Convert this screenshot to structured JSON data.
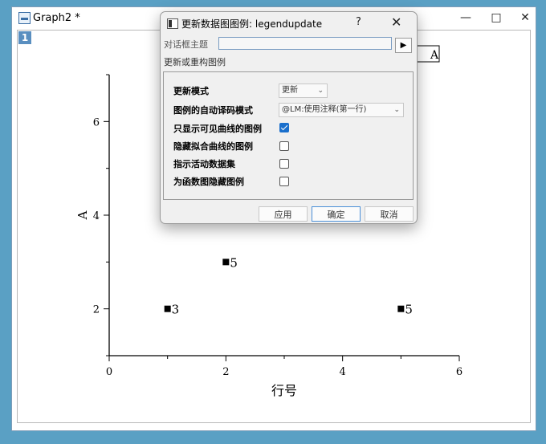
{
  "graph_window": {
    "title": "Graph2 *",
    "layer_number": "1",
    "controls": {
      "minimize": "—",
      "maximize": "□",
      "close": "✕"
    }
  },
  "dialog": {
    "title": "更新数据图图例: legendupdate",
    "help": "?",
    "close": "✕",
    "theme_label": "对话框主题",
    "theme_value": "",
    "section_label": "更新或重构图例",
    "options": {
      "update_mode_label": "更新模式",
      "update_mode_value": "更新",
      "auto_translate_label": "图例的自动译码模式",
      "auto_translate_value": "@LM:使用注释(第一行)",
      "visible_only_label": "只显示可见曲线的图例",
      "visible_only_checked": true,
      "hide_fit_label": "隐藏拟合曲线的图例",
      "hide_fit_checked": false,
      "active_dataset_label": "指示活动数据集",
      "active_dataset_checked": false,
      "hide_function_label": "为函数图隐藏图例",
      "hide_function_checked": false
    },
    "buttons": {
      "apply": "应用",
      "ok": "确定",
      "cancel": "取消"
    }
  },
  "chart_data": {
    "type": "scatter",
    "xlabel": "行号",
    "ylabel": "A",
    "xlim": [
      0,
      6
    ],
    "ylim": [
      1,
      7
    ],
    "x_ticks": [
      "0",
      "2",
      "4",
      "6"
    ],
    "y_ticks": [
      "2",
      "4",
      "6"
    ],
    "legend": [
      "A"
    ],
    "points": [
      {
        "x": 1,
        "y": 2,
        "label": "3"
      },
      {
        "x": 2,
        "y": 3,
        "label": "5"
      },
      {
        "x": 5,
        "y": 2,
        "label": "5"
      }
    ],
    "marker": "square",
    "marker_color": "#000000"
  }
}
